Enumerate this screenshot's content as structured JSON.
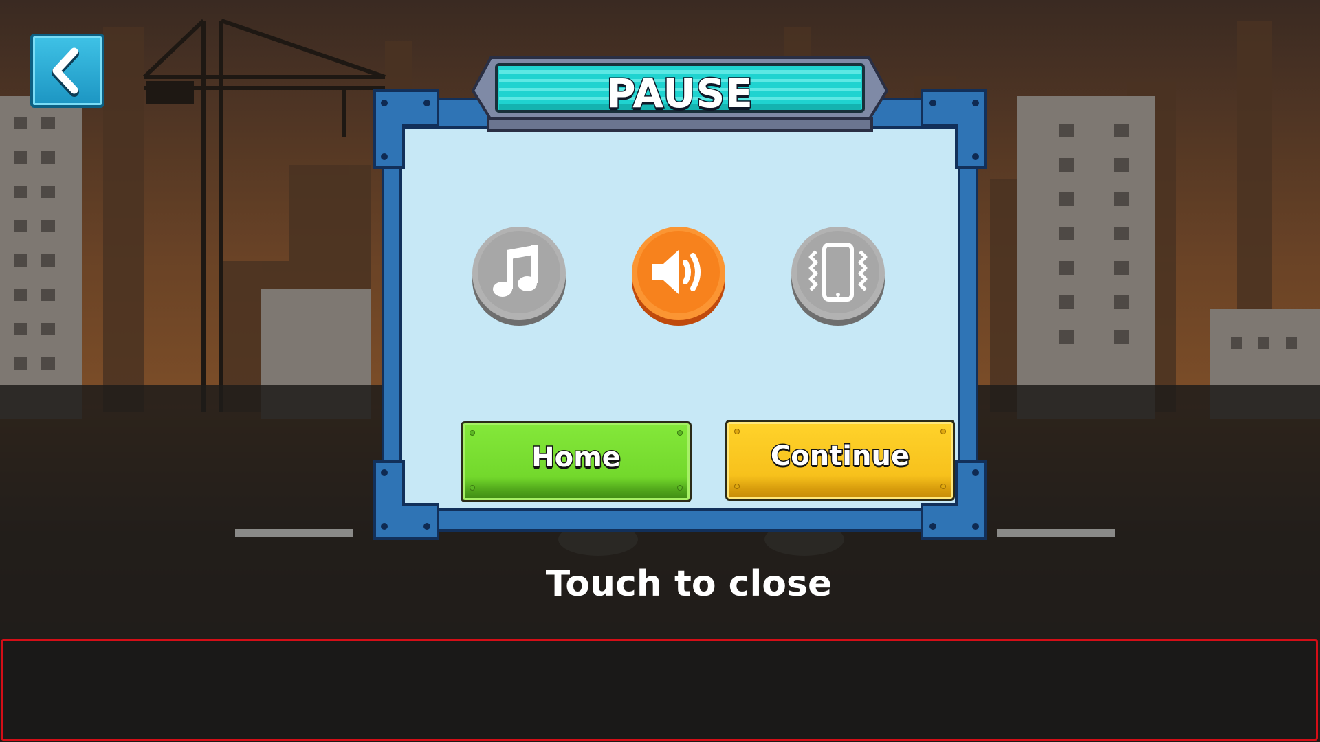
{
  "dialog": {
    "title": "PAUSE",
    "home_label": "Home",
    "continue_label": "Continue"
  },
  "toggles": [
    {
      "name": "music",
      "icon": "music-note-icon",
      "state": "off",
      "color": "#a9a9a9"
    },
    {
      "name": "sound",
      "icon": "speaker-icon",
      "state": "on",
      "color": "#f7801c"
    },
    {
      "name": "vibration",
      "icon": "phone-vibrate-icon",
      "state": "off",
      "color": "#a9a9a9"
    }
  ],
  "hint": "Touch to close",
  "back_button": {
    "icon": "chevron-left-icon"
  },
  "colors": {
    "sky": "#5a3a22",
    "frame_blue": "#2f74b5",
    "panel_fill": "#c7e8f6",
    "title_bar": "#1fd3d0",
    "home_green": "#78dd30",
    "continue_yellow": "#f9c31e",
    "ad_border": "#d40e17"
  }
}
